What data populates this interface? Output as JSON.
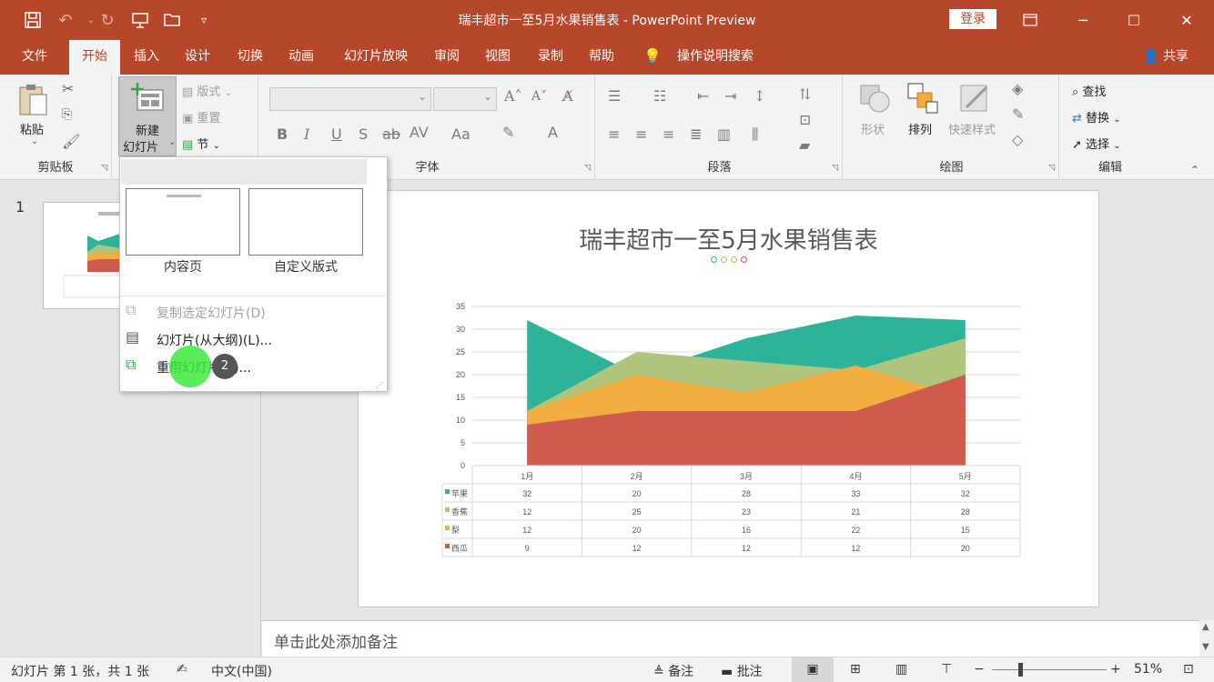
{
  "window": {
    "title": "瑞丰超市一至5月水果销售表  -  PowerPoint Preview",
    "login_label": "登录",
    "quick_access": [
      "save-icon",
      "undo-icon",
      "redo-icon",
      "present-icon",
      "open-icon",
      "customize-icon"
    ]
  },
  "tabs": [
    "文件",
    "开始",
    "插入",
    "设计",
    "切换",
    "动画",
    "幻灯片放映",
    "审阅",
    "视图",
    "录制",
    "帮助",
    "操作说明搜索"
  ],
  "share_label": "共享",
  "ribbon": {
    "clipboard": {
      "paste": "粘贴",
      "group": "剪贴板"
    },
    "slides": {
      "new_slide_1": "新建",
      "new_slide_2": "幻灯片",
      "layout": "版式",
      "reset": "重置",
      "section": "节"
    },
    "font": {
      "group": "字体"
    },
    "paragraph": {
      "group": "段落"
    },
    "drawing": {
      "shape": "形状",
      "arrange": "排列",
      "quick_styles": "快速样式",
      "group": "绘图"
    },
    "editing": {
      "find": "查找",
      "replace": "替换",
      "select": "选择",
      "group": "编辑"
    }
  },
  "slides_panel": {
    "number": "1"
  },
  "dropdown": {
    "layouts": [
      "内容页",
      "自定义版式"
    ],
    "duplicate": "复制选定幻灯片(D)",
    "from_outline": "幻灯片(从大纲)(L)...",
    "reuse": "重用幻灯片(R)...",
    "cursor_badge": "2"
  },
  "slide": {
    "title": "瑞丰超市一至5月水果销售表",
    "dot_colors": [
      "#2eb39b",
      "#a7c27a",
      "#f0ad3a",
      "#d0514b"
    ]
  },
  "chart_data": {
    "type": "area",
    "categories": [
      "1月",
      "2月",
      "3月",
      "4月",
      "5月"
    ],
    "ylim": [
      0,
      35
    ],
    "yticks": [
      "0",
      "5",
      "10",
      "15",
      "20",
      "25",
      "30",
      "35"
    ],
    "series": [
      {
        "name": "苹果",
        "values": [
          32,
          20,
          28,
          33,
          32
        ],
        "color": "#2eb39b"
      },
      {
        "name": "香蕉",
        "values": [
          12,
          25,
          23,
          21,
          28
        ],
        "color": "#b0c67e"
      },
      {
        "name": "梨",
        "values": [
          12,
          20,
          16,
          22,
          15
        ],
        "color": "#f2ae3e"
      },
      {
        "name": "西瓜",
        "values": [
          9,
          12,
          12,
          12,
          20
        ],
        "color": "#d05a4e"
      }
    ],
    "grid": true,
    "data_table": true
  },
  "notes": {
    "placeholder": "单击此处添加备注"
  },
  "status": {
    "slide_info": "幻灯片 第 1 张，共 1 张",
    "language": "中文(中国)",
    "notes": "备注",
    "comments": "批注",
    "zoom": "51%"
  }
}
